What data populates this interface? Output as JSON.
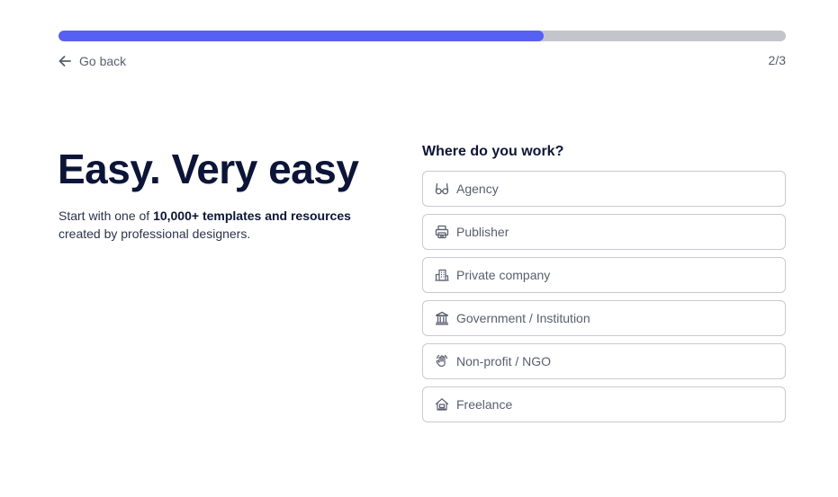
{
  "progress": {
    "fraction": 0.667,
    "fill_color": "#5660f2",
    "track_color": "#c4c5cc"
  },
  "nav": {
    "back_label": "Go back",
    "back_icon": "arrow-left-icon",
    "step_counter": "2/3"
  },
  "hero": {
    "headline": "Easy. Very easy",
    "sub_prefix": "Start with one of ",
    "sub_bold": "10,000+ templates and resources",
    "sub_suffix": " created by professional designers."
  },
  "form": {
    "question": "Where do you work?",
    "options": [
      {
        "label": "Agency",
        "icon": "glasses-icon"
      },
      {
        "label": "Publisher",
        "icon": "printer-icon"
      },
      {
        "label": "Private company",
        "icon": "building-icon"
      },
      {
        "label": "Government / Institution",
        "icon": "institution-icon"
      },
      {
        "label": "Non-profit / NGO",
        "icon": "raised-hand-icon"
      },
      {
        "label": "Freelance",
        "icon": "home-icon"
      }
    ]
  }
}
